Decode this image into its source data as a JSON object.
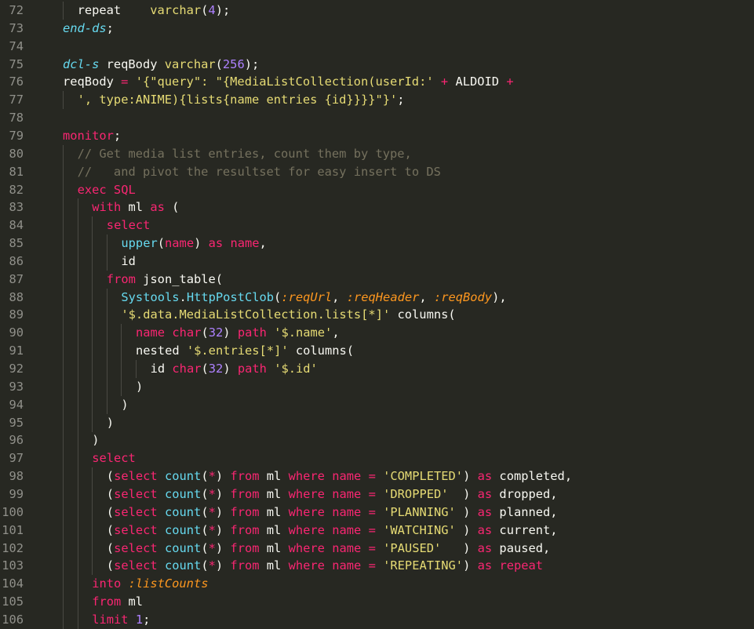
{
  "editor": {
    "theme": {
      "background": "#272822",
      "foreground": "#f8f8f2",
      "keyword": "#f92672",
      "function": "#66d9ef",
      "string": "#e6db74",
      "number": "#ae81ff",
      "comment": "#75715e",
      "variable": "#fd971f",
      "line_number": "#90908a"
    },
    "lines": [
      {
        "n": "72",
        "indent": 1,
        "tokens": [
          [
            "pl",
            "repeat    "
          ],
          [
            "str",
            "varchar"
          ],
          [
            "pl",
            "("
          ],
          [
            "num",
            "4"
          ],
          [
            "pl",
            ");"
          ]
        ]
      },
      {
        "n": "73",
        "indent": 0,
        "tokens": [
          [
            "it",
            "end-ds"
          ],
          [
            "pl",
            ";"
          ]
        ]
      },
      {
        "n": "74",
        "indent": 0,
        "tokens": []
      },
      {
        "n": "75",
        "indent": 0,
        "tokens": [
          [
            "it",
            "dcl-s"
          ],
          [
            "pl",
            " reqBody "
          ],
          [
            "str",
            "varchar"
          ],
          [
            "pl",
            "("
          ],
          [
            "num",
            "256"
          ],
          [
            "pl",
            ");"
          ]
        ]
      },
      {
        "n": "76",
        "indent": 0,
        "tokens": [
          [
            "pl",
            "reqBody "
          ],
          [
            "kw",
            "="
          ],
          [
            "pl",
            " "
          ],
          [
            "str",
            "'{\"query\": \"{MediaListCollection(userId:'"
          ],
          [
            "pl",
            " "
          ],
          [
            "kw",
            "+"
          ],
          [
            "pl",
            " ALDOID "
          ],
          [
            "kw",
            "+"
          ]
        ]
      },
      {
        "n": "77",
        "indent": 1,
        "tokens": [
          [
            "str",
            "', type:ANIME){lists{name entries {id}}}}\"}'"
          ],
          [
            "pl",
            ";"
          ]
        ]
      },
      {
        "n": "78",
        "indent": 0,
        "tokens": []
      },
      {
        "n": "79",
        "indent": 0,
        "tokens": [
          [
            "kw",
            "monitor"
          ],
          [
            "pl",
            ";"
          ]
        ]
      },
      {
        "n": "80",
        "indent": 1,
        "tokens": [
          [
            "cmt",
            "// Get media list entries, count them by type,"
          ]
        ]
      },
      {
        "n": "81",
        "indent": 1,
        "tokens": [
          [
            "cmt",
            "//   and pivot the resultset for easy insert to DS"
          ]
        ]
      },
      {
        "n": "82",
        "indent": 1,
        "tokens": [
          [
            "kw",
            "exec SQL"
          ]
        ]
      },
      {
        "n": "83",
        "indent": 2,
        "tokens": [
          [
            "kw",
            "with"
          ],
          [
            "pl",
            " ml "
          ],
          [
            "kw",
            "as"
          ],
          [
            "pl",
            " ("
          ]
        ]
      },
      {
        "n": "84",
        "indent": 3,
        "tokens": [
          [
            "kw",
            "select"
          ]
        ]
      },
      {
        "n": "85",
        "indent": 4,
        "tokens": [
          [
            "fn",
            "upper"
          ],
          [
            "pl",
            "("
          ],
          [
            "kw",
            "name"
          ],
          [
            "pl",
            ") "
          ],
          [
            "kw",
            "as"
          ],
          [
            "pl",
            " "
          ],
          [
            "kw",
            "name"
          ],
          [
            "pl",
            ","
          ]
        ]
      },
      {
        "n": "86",
        "indent": 4,
        "tokens": [
          [
            "pl",
            "id"
          ]
        ]
      },
      {
        "n": "87",
        "indent": 3,
        "tokens": [
          [
            "kw",
            "from"
          ],
          [
            "pl",
            " json_table("
          ]
        ]
      },
      {
        "n": "88",
        "indent": 4,
        "tokens": [
          [
            "fn",
            "Systools"
          ],
          [
            "pl",
            "."
          ],
          [
            "fn",
            "HttpPostClob"
          ],
          [
            "pl",
            "("
          ],
          [
            "var",
            ":reqUrl"
          ],
          [
            "pl",
            ", "
          ],
          [
            "var",
            ":reqHeader"
          ],
          [
            "pl",
            ", "
          ],
          [
            "var",
            ":reqBody"
          ],
          [
            "pl",
            "),"
          ]
        ]
      },
      {
        "n": "89",
        "indent": 4,
        "tokens": [
          [
            "str",
            "'$.data.MediaListCollection.lists[*]'"
          ],
          [
            "pl",
            " columns("
          ]
        ]
      },
      {
        "n": "90",
        "indent": 5,
        "tokens": [
          [
            "kw",
            "name"
          ],
          [
            "pl",
            " "
          ],
          [
            "kw",
            "char"
          ],
          [
            "pl",
            "("
          ],
          [
            "num",
            "32"
          ],
          [
            "pl",
            ") "
          ],
          [
            "kw",
            "path"
          ],
          [
            "pl",
            " "
          ],
          [
            "str",
            "'$.name'"
          ],
          [
            "pl",
            ","
          ]
        ]
      },
      {
        "n": "91",
        "indent": 5,
        "tokens": [
          [
            "pl",
            "nested "
          ],
          [
            "str",
            "'$.entries[*]'"
          ],
          [
            "pl",
            " columns("
          ]
        ]
      },
      {
        "n": "92",
        "indent": 6,
        "tokens": [
          [
            "pl",
            "id "
          ],
          [
            "kw",
            "char"
          ],
          [
            "pl",
            "("
          ],
          [
            "num",
            "32"
          ],
          [
            "pl",
            ") "
          ],
          [
            "kw",
            "path"
          ],
          [
            "pl",
            " "
          ],
          [
            "str",
            "'$.id'"
          ]
        ]
      },
      {
        "n": "93",
        "indent": 5,
        "tokens": [
          [
            "pl",
            ")"
          ]
        ]
      },
      {
        "n": "94",
        "indent": 4,
        "tokens": [
          [
            "pl",
            ")"
          ]
        ]
      },
      {
        "n": "95",
        "indent": 3,
        "tokens": [
          [
            "pl",
            ")"
          ]
        ]
      },
      {
        "n": "96",
        "indent": 2,
        "tokens": [
          [
            "pl",
            ")"
          ]
        ]
      },
      {
        "n": "97",
        "indent": 2,
        "tokens": [
          [
            "kw",
            "select"
          ]
        ]
      },
      {
        "n": "98",
        "indent": 3,
        "tokens": [
          [
            "pl",
            "("
          ],
          [
            "kw",
            "select"
          ],
          [
            "pl",
            " "
          ],
          [
            "fn",
            "count"
          ],
          [
            "pl",
            "("
          ],
          [
            "kw",
            "*"
          ],
          [
            "pl",
            ") "
          ],
          [
            "kw",
            "from"
          ],
          [
            "pl",
            " ml "
          ],
          [
            "kw",
            "where"
          ],
          [
            "pl",
            " "
          ],
          [
            "kw",
            "name"
          ],
          [
            "pl",
            " "
          ],
          [
            "kw",
            "="
          ],
          [
            "pl",
            " "
          ],
          [
            "str",
            "'COMPLETED'"
          ],
          [
            "pl",
            ") "
          ],
          [
            "kw",
            "as"
          ],
          [
            "pl",
            " completed,"
          ]
        ]
      },
      {
        "n": "99",
        "indent": 3,
        "tokens": [
          [
            "pl",
            "("
          ],
          [
            "kw",
            "select"
          ],
          [
            "pl",
            " "
          ],
          [
            "fn",
            "count"
          ],
          [
            "pl",
            "("
          ],
          [
            "kw",
            "*"
          ],
          [
            "pl",
            ") "
          ],
          [
            "kw",
            "from"
          ],
          [
            "pl",
            " ml "
          ],
          [
            "kw",
            "where"
          ],
          [
            "pl",
            " "
          ],
          [
            "kw",
            "name"
          ],
          [
            "pl",
            " "
          ],
          [
            "kw",
            "="
          ],
          [
            "pl",
            " "
          ],
          [
            "str",
            "'DROPPED'"
          ],
          [
            "pl",
            "  ) "
          ],
          [
            "kw",
            "as"
          ],
          [
            "pl",
            " dropped,"
          ]
        ]
      },
      {
        "n": "100",
        "indent": 3,
        "tokens": [
          [
            "pl",
            "("
          ],
          [
            "kw",
            "select"
          ],
          [
            "pl",
            " "
          ],
          [
            "fn",
            "count"
          ],
          [
            "pl",
            "("
          ],
          [
            "kw",
            "*"
          ],
          [
            "pl",
            ") "
          ],
          [
            "kw",
            "from"
          ],
          [
            "pl",
            " ml "
          ],
          [
            "kw",
            "where"
          ],
          [
            "pl",
            " "
          ],
          [
            "kw",
            "name"
          ],
          [
            "pl",
            " "
          ],
          [
            "kw",
            "="
          ],
          [
            "pl",
            " "
          ],
          [
            "str",
            "'PLANNING'"
          ],
          [
            "pl",
            " ) "
          ],
          [
            "kw",
            "as"
          ],
          [
            "pl",
            " planned,"
          ]
        ]
      },
      {
        "n": "101",
        "indent": 3,
        "tokens": [
          [
            "pl",
            "("
          ],
          [
            "kw",
            "select"
          ],
          [
            "pl",
            " "
          ],
          [
            "fn",
            "count"
          ],
          [
            "pl",
            "("
          ],
          [
            "kw",
            "*"
          ],
          [
            "pl",
            ") "
          ],
          [
            "kw",
            "from"
          ],
          [
            "pl",
            " ml "
          ],
          [
            "kw",
            "where"
          ],
          [
            "pl",
            " "
          ],
          [
            "kw",
            "name"
          ],
          [
            "pl",
            " "
          ],
          [
            "kw",
            "="
          ],
          [
            "pl",
            " "
          ],
          [
            "str",
            "'WATCHING'"
          ],
          [
            "pl",
            " ) "
          ],
          [
            "kw",
            "as"
          ],
          [
            "pl",
            " current,"
          ]
        ]
      },
      {
        "n": "102",
        "indent": 3,
        "tokens": [
          [
            "pl",
            "("
          ],
          [
            "kw",
            "select"
          ],
          [
            "pl",
            " "
          ],
          [
            "fn",
            "count"
          ],
          [
            "pl",
            "("
          ],
          [
            "kw",
            "*"
          ],
          [
            "pl",
            ") "
          ],
          [
            "kw",
            "from"
          ],
          [
            "pl",
            " ml "
          ],
          [
            "kw",
            "where"
          ],
          [
            "pl",
            " "
          ],
          [
            "kw",
            "name"
          ],
          [
            "pl",
            " "
          ],
          [
            "kw",
            "="
          ],
          [
            "pl",
            " "
          ],
          [
            "str",
            "'PAUSED'"
          ],
          [
            "pl",
            "   ) "
          ],
          [
            "kw",
            "as"
          ],
          [
            "pl",
            " paused,"
          ]
        ]
      },
      {
        "n": "103",
        "indent": 3,
        "tokens": [
          [
            "pl",
            "("
          ],
          [
            "kw",
            "select"
          ],
          [
            "pl",
            " "
          ],
          [
            "fn",
            "count"
          ],
          [
            "pl",
            "("
          ],
          [
            "kw",
            "*"
          ],
          [
            "pl",
            ") "
          ],
          [
            "kw",
            "from"
          ],
          [
            "pl",
            " ml "
          ],
          [
            "kw",
            "where"
          ],
          [
            "pl",
            " "
          ],
          [
            "kw",
            "name"
          ],
          [
            "pl",
            " "
          ],
          [
            "kw",
            "="
          ],
          [
            "pl",
            " "
          ],
          [
            "str",
            "'REPEATING'"
          ],
          [
            "pl",
            ") "
          ],
          [
            "kw",
            "as"
          ],
          [
            "pl",
            " "
          ],
          [
            "kw",
            "repeat"
          ]
        ]
      },
      {
        "n": "104",
        "indent": 2,
        "tokens": [
          [
            "kw",
            "into"
          ],
          [
            "pl",
            " "
          ],
          [
            "var",
            ":listCounts"
          ]
        ]
      },
      {
        "n": "105",
        "indent": 2,
        "tokens": [
          [
            "kw",
            "from"
          ],
          [
            "pl",
            " ml"
          ]
        ]
      },
      {
        "n": "106",
        "indent": 2,
        "tokens": [
          [
            "kw",
            "limit"
          ],
          [
            "pl",
            " "
          ],
          [
            "num",
            "1"
          ],
          [
            "pl",
            ";"
          ]
        ]
      }
    ]
  }
}
